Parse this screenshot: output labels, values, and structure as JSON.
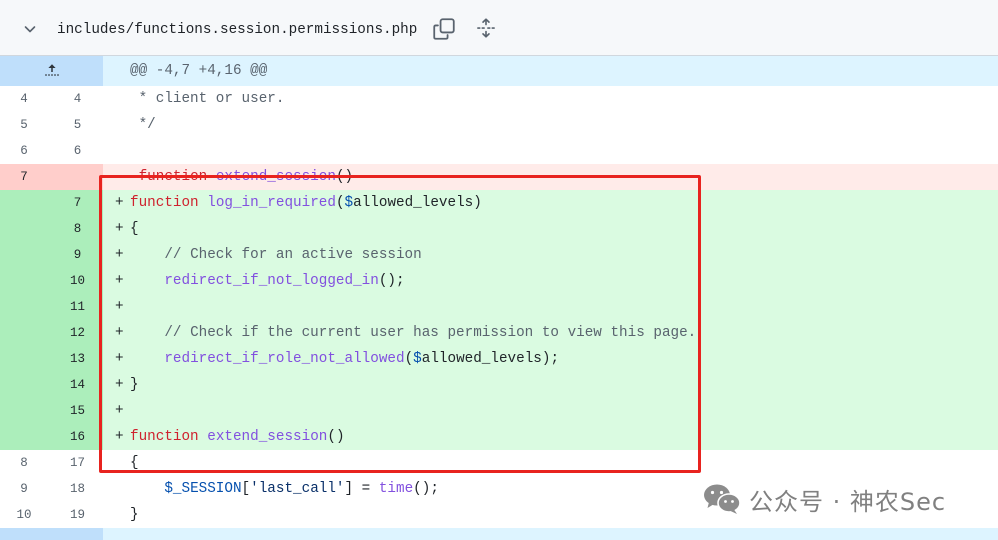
{
  "file_header": {
    "path": "includes/functions.session.permissions.php",
    "collapse_icon": "chevron-down-icon",
    "copy_icon": "copy-icon",
    "expand_all_icon": "unfold-icon"
  },
  "hunk": {
    "header": "@@ -4,7 +4,16 @@",
    "expand_icon": "fold-up-icon"
  },
  "syntax_colors": {
    "keyword": "#cf222e",
    "function_name": "#8250df",
    "variable": "#0550ae",
    "comment": "#59636e",
    "string": "#0a3069",
    "plain": "#1f2328"
  },
  "diff_colors": {
    "added_line_bg": "#dafbe1",
    "added_number_bg": "#aceebb",
    "deleted_line_bg": "#ffebe9",
    "deleted_number_bg": "#ffcecb",
    "hunk_line_bg": "#ddf4ff",
    "hunk_number_bg": "#bfdffb",
    "annotation_border": "#e8231f"
  },
  "rows": [
    {
      "old": 4,
      "new": 4,
      "sign": "",
      "tokens": [
        {
          "s": " * client or user.",
          "color": "#59636e"
        }
      ]
    },
    {
      "old": 5,
      "new": 5,
      "sign": "",
      "tokens": [
        {
          "s": " */",
          "color": "#59636e"
        }
      ]
    },
    {
      "old": 6,
      "new": 6,
      "sign": "",
      "tokens": []
    },
    {
      "old": 7,
      "new": null,
      "sign": "-",
      "tokens": [
        {
          "s": " ",
          "color": "#1f2328"
        },
        {
          "s": "function",
          "color": "#cf222e"
        },
        {
          "s": " ",
          "color": "#1f2328"
        },
        {
          "s": "extend_session",
          "color": "#8250df"
        },
        {
          "s": "()",
          "color": "#1f2328"
        }
      ]
    },
    {
      "old": null,
      "new": 7,
      "sign": "+",
      "tokens": [
        {
          "s": "function",
          "color": "#cf222e"
        },
        {
          "s": " ",
          "color": "#1f2328"
        },
        {
          "s": "log_in_required",
          "color": "#8250df"
        },
        {
          "s": "(",
          "color": "#1f2328"
        },
        {
          "s": "$",
          "color": "#0550ae"
        },
        {
          "s": "allowed_levels)",
          "color": "#1f2328"
        }
      ]
    },
    {
      "old": null,
      "new": 8,
      "sign": "+",
      "tokens": [
        {
          "s": "{",
          "color": "#1f2328"
        }
      ]
    },
    {
      "old": null,
      "new": 9,
      "sign": "+",
      "tokens": [
        {
          "s": "    ",
          "color": "#1f2328"
        },
        {
          "s": "// Check for an active session",
          "color": "#59636e"
        }
      ]
    },
    {
      "old": null,
      "new": 10,
      "sign": "+",
      "tokens": [
        {
          "s": "    ",
          "color": "#1f2328"
        },
        {
          "s": "redirect_if_not_logged_in",
          "color": "#8250df"
        },
        {
          "s": "();",
          "color": "#1f2328"
        }
      ]
    },
    {
      "old": null,
      "new": 11,
      "sign": "+",
      "tokens": []
    },
    {
      "old": null,
      "new": 12,
      "sign": "+",
      "tokens": [
        {
          "s": "    ",
          "color": "#1f2328"
        },
        {
          "s": "// Check if the current user has permission to view this page.",
          "color": "#59636e"
        }
      ]
    },
    {
      "old": null,
      "new": 13,
      "sign": "+",
      "tokens": [
        {
          "s": "    ",
          "color": "#1f2328"
        },
        {
          "s": "redirect_if_role_not_allowed",
          "color": "#8250df"
        },
        {
          "s": "(",
          "color": "#1f2328"
        },
        {
          "s": "$",
          "color": "#0550ae"
        },
        {
          "s": "allowed_levels);",
          "color": "#1f2328"
        }
      ]
    },
    {
      "old": null,
      "new": 14,
      "sign": "+",
      "tokens": [
        {
          "s": "}",
          "color": "#1f2328"
        }
      ]
    },
    {
      "old": null,
      "new": 15,
      "sign": "+",
      "tokens": []
    },
    {
      "old": null,
      "new": 16,
      "sign": "+",
      "tokens": [
        {
          "s": "function",
          "color": "#cf222e"
        },
        {
          "s": " ",
          "color": "#1f2328"
        },
        {
          "s": "extend_session",
          "color": "#8250df"
        },
        {
          "s": "()",
          "color": "#1f2328"
        }
      ]
    },
    {
      "old": 8,
      "new": 17,
      "sign": "",
      "tokens": [
        {
          "s": "{",
          "color": "#1f2328"
        }
      ]
    },
    {
      "old": 9,
      "new": 18,
      "sign": "",
      "tokens": [
        {
          "s": "    ",
          "color": "#1f2328"
        },
        {
          "s": "$_SESSION",
          "color": "#0550ae"
        },
        {
          "s": "[",
          "color": "#1f2328"
        },
        {
          "s": "'last_call'",
          "color": "#0a3069"
        },
        {
          "s": "] = ",
          "color": "#1f2328"
        },
        {
          "s": "time",
          "color": "#8250df"
        },
        {
          "s": "();",
          "color": "#1f2328"
        }
      ]
    },
    {
      "old": 10,
      "new": 19,
      "sign": "",
      "tokens": [
        {
          "s": "}",
          "color": "#1f2328"
        }
      ]
    }
  ],
  "watermark": {
    "text": "公众号 · 神农Sec",
    "icon": "wechat-icon"
  }
}
